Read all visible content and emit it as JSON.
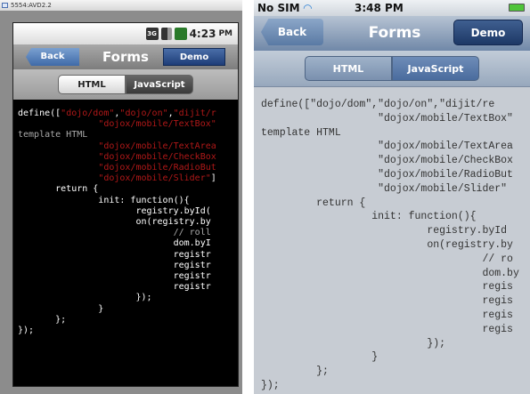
{
  "android": {
    "window_title": "5554:AVD2.2",
    "status": {
      "network": "3G",
      "time": "4:23",
      "ampm": "PM"
    },
    "nav": {
      "back": "Back",
      "title": "Forms",
      "demo": "Demo"
    },
    "tabs": [
      {
        "label": "HTML"
      },
      {
        "label": "JavaScript"
      }
    ],
    "code": [
      [
        {
          "t": "define([",
          "k": "plain"
        },
        {
          "t": "\"dojo/dom\"",
          "k": "string"
        },
        {
          "t": ",",
          "k": "plain"
        },
        {
          "t": "\"dojo/on\"",
          "k": "string"
        },
        {
          "t": ",",
          "k": "plain"
        },
        {
          "t": "\"dijit/r",
          "k": "string"
        }
      ],
      [
        {
          "t": "               ",
          "k": "plain"
        },
        {
          "t": "\"dojox/mobile/TextBox\"",
          "k": "string"
        }
      ],
      [
        {
          "t": "template HTML",
          "k": "comment"
        }
      ],
      [
        {
          "t": "               ",
          "k": "plain"
        },
        {
          "t": "\"dojox/mobile/TextArea",
          "k": "string"
        }
      ],
      [
        {
          "t": "               ",
          "k": "plain"
        },
        {
          "t": "\"dojox/mobile/CheckBox",
          "k": "string"
        }
      ],
      [
        {
          "t": "               ",
          "k": "plain"
        },
        {
          "t": "\"dojox/mobile/RadioBut",
          "k": "string"
        }
      ],
      [
        {
          "t": "               ",
          "k": "plain"
        },
        {
          "t": "\"dojox/mobile/Slider\"",
          "k": "string"
        },
        {
          "t": "]",
          "k": "plain"
        }
      ],
      [
        {
          "t": "       return {",
          "k": "plain"
        }
      ],
      [
        {
          "t": "               init: function(){",
          "k": "plain"
        }
      ],
      [
        {
          "t": "                      registry.byId(",
          "k": "plain"
        }
      ],
      [
        {
          "t": "                      on(registry.by",
          "k": "plain"
        }
      ],
      [
        {
          "t": "                             // roll",
          "k": "comment"
        }
      ],
      [
        {
          "t": "                             dom.byI",
          "k": "plain"
        }
      ],
      [
        {
          "t": "                             registr",
          "k": "plain"
        }
      ],
      [
        {
          "t": "                             registr",
          "k": "plain"
        }
      ],
      [
        {
          "t": "                             registr",
          "k": "plain"
        }
      ],
      [
        {
          "t": "                             registr",
          "k": "plain"
        }
      ],
      [
        {
          "t": "                      });",
          "k": "plain"
        }
      ],
      [
        {
          "t": "               }",
          "k": "plain"
        }
      ],
      [
        {
          "t": "       };",
          "k": "plain"
        }
      ],
      [
        {
          "t": "});",
          "k": "plain"
        }
      ]
    ]
  },
  "ios": {
    "status": {
      "carrier": "No SIM",
      "time": "3:48 PM"
    },
    "nav": {
      "back": "Back",
      "title": "Forms",
      "demo": "Demo"
    },
    "tabs": [
      {
        "label": "HTML"
      },
      {
        "label": "JavaScript"
      }
    ],
    "code": [
      [
        {
          "t": "define([\"dojo/dom\",\"dojo/on\",\"dijit/re",
          "k": "plain"
        }
      ],
      [
        {
          "t": "                   \"dojox/mobile/TextBox\"",
          "k": "plain"
        }
      ],
      [
        {
          "t": "template HTML",
          "k": "plain"
        }
      ],
      [
        {
          "t": "                   \"dojox/mobile/TextArea",
          "k": "plain"
        }
      ],
      [
        {
          "t": "                   \"dojox/mobile/CheckBox",
          "k": "plain"
        }
      ],
      [
        {
          "t": "                   \"dojox/mobile/RadioBut",
          "k": "plain"
        }
      ],
      [
        {
          "t": "                   \"dojox/mobile/Slider\"",
          "k": "plain"
        }
      ],
      [
        {
          "t": "         return {",
          "k": "plain"
        }
      ],
      [
        {
          "t": "                  init: function(){",
          "k": "plain"
        }
      ],
      [
        {
          "t": "                           registry.byId",
          "k": "plain"
        }
      ],
      [
        {
          "t": "                           on(registry.by",
          "k": "plain"
        }
      ],
      [
        {
          "t": "                                    // ro",
          "k": "plain"
        }
      ],
      [
        {
          "t": "                                    dom.by",
          "k": "plain"
        }
      ],
      [
        {
          "t": "                                    regis",
          "k": "plain"
        }
      ],
      [
        {
          "t": "                                    regis",
          "k": "plain"
        }
      ],
      [
        {
          "t": "                                    regis",
          "k": "plain"
        }
      ],
      [
        {
          "t": "                                    regis",
          "k": "plain"
        }
      ],
      [
        {
          "t": "                           });",
          "k": "plain"
        }
      ],
      [
        {
          "t": "                  }",
          "k": "plain"
        }
      ],
      [
        {
          "t": "         };",
          "k": "plain"
        }
      ],
      [
        {
          "t": "});",
          "k": "plain"
        }
      ]
    ]
  }
}
